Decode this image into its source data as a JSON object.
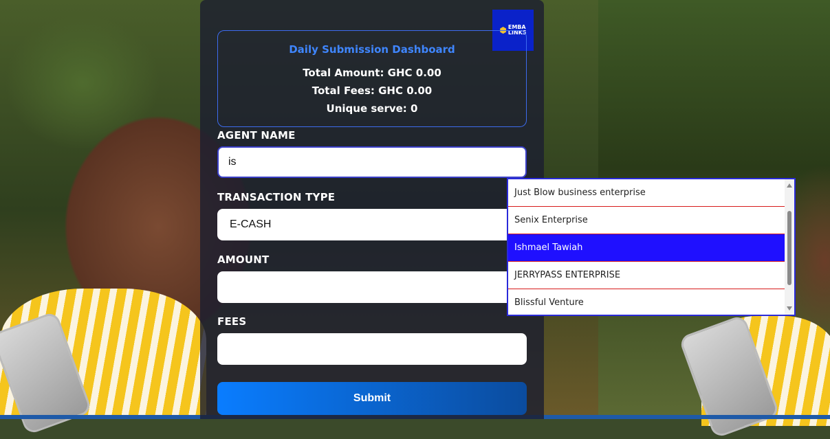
{
  "dashboard": {
    "title": "Daily Submission Dashboard",
    "total_amount": "Total Amount: GHC 0.00",
    "total_fees": "Total Fees: GHC 0.00",
    "unique_serve": "Unique serve: 0"
  },
  "logo": {
    "line1": "EMBA",
    "line2": "LINKS"
  },
  "form": {
    "agent_name_label": "AGENT NAME",
    "agent_name_value": "is",
    "transaction_type_label": "TRANSACTION TYPE",
    "transaction_type_value": "E-CASH",
    "amount_label": "AMOUNT",
    "amount_value": "",
    "fees_label": "FEES",
    "fees_value": "",
    "submit_label": "Submit"
  },
  "suggestions": {
    "items": [
      "Just Blow business enterprise",
      "Senix Enterprise",
      "Ishmael Tawiah",
      "JERRYPASS ENTERPRISE",
      "Blissful Venture"
    ],
    "selected": "Ishmael Tawiah"
  },
  "colors": {
    "accent": "#3f86ff",
    "selected_option": "#1f10ff",
    "option_divider": "#d71a1a",
    "logo_bg": "#0a22c9"
  }
}
